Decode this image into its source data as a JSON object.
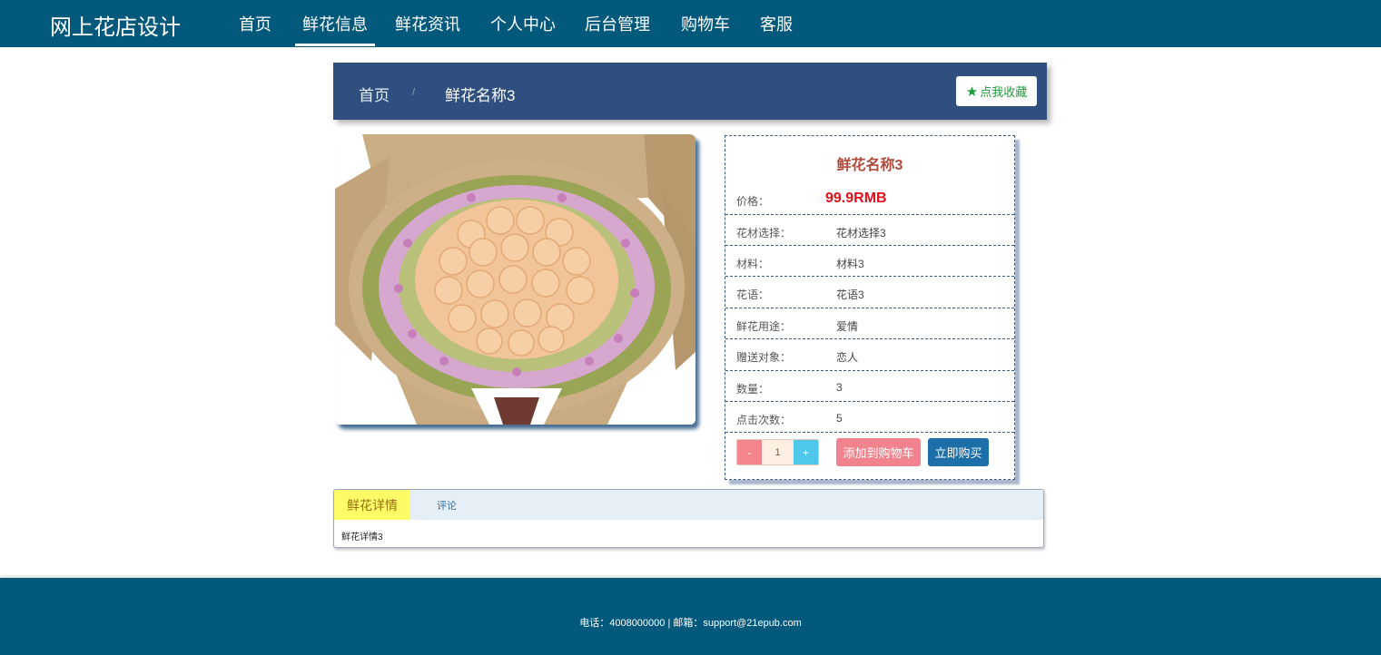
{
  "nav": {
    "brand": "网上花店设计",
    "items": [
      {
        "label": "首页",
        "active": false
      },
      {
        "label": "鲜花信息",
        "active": true
      },
      {
        "label": "鲜花资讯",
        "active": false
      },
      {
        "label": "个人中心",
        "active": false
      },
      {
        "label": "后台管理",
        "active": false
      },
      {
        "label": "购物车",
        "active": false
      },
      {
        "label": "客服",
        "active": false
      }
    ]
  },
  "breadcrumb": {
    "home": "首页",
    "separator": "/",
    "current": "鲜花名称3",
    "favorite_label": "点我收藏"
  },
  "product": {
    "title": "鲜花名称3",
    "price_label": "价格：",
    "price_value": "99.9RMB",
    "rows": [
      {
        "key": "花材选择：",
        "value": "花材选择3"
      },
      {
        "key": "材料：",
        "value": "材料3"
      },
      {
        "key": "花语：",
        "value": "花语3"
      },
      {
        "key": "鲜花用途：",
        "value": "爱情"
      },
      {
        "key": "赠送对象：",
        "value": "恋人"
      },
      {
        "key": "数量：",
        "value": "3"
      },
      {
        "key": "点击次数：",
        "value": "5"
      }
    ],
    "qty_minus": "-",
    "qty_value": "1",
    "qty_plus": "+",
    "add_to_cart": "添加到购物车",
    "buy_now": "立即购买"
  },
  "tabs": {
    "detail_label": "鲜花详情",
    "comment_label": "评论",
    "content": "鲜花详情3"
  },
  "footer": {
    "text": "电话：4008000000 | 邮箱：support@21epub.com"
  },
  "colors": {
    "nav_bg": "#03597b",
    "breadcrumb_bg": "#2f507f",
    "price": "#e0101a",
    "cart_button": "#f1838e",
    "buy_button": "#1d6fa9"
  }
}
